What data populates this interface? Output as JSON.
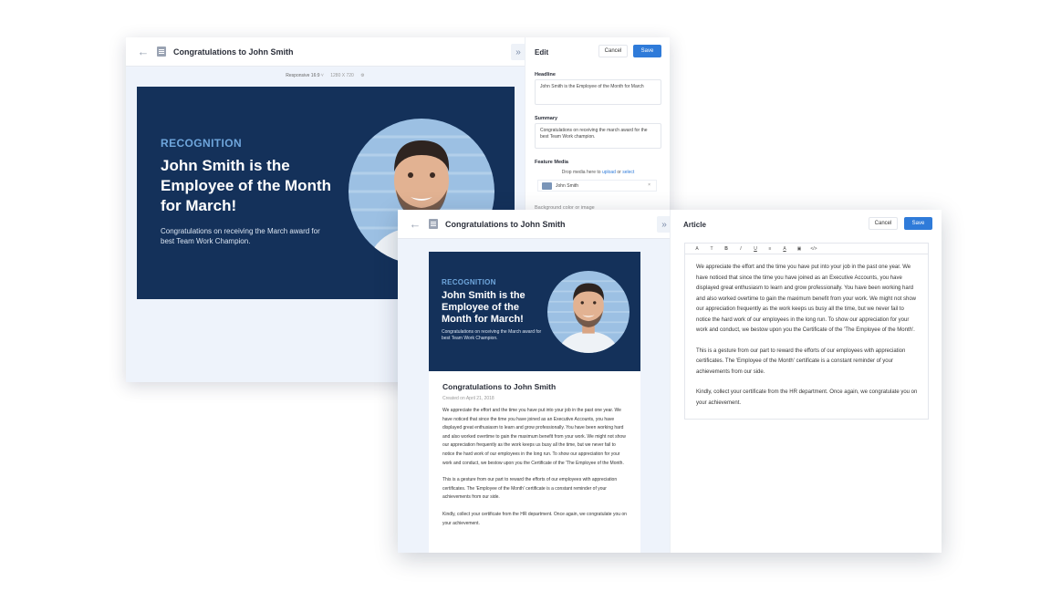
{
  "back_window": {
    "title": "Congratulations to John Smith",
    "responsive_label": "Responsive 16:9",
    "resolution": "1280 X 720",
    "panel_title": "Edit",
    "cancel_label": "Cancel",
    "save_label": "Save",
    "banner": {
      "kicker": "RECOGNITION",
      "headline": "John Smith is the Employee of the Month for March!",
      "subline": "Congratulations on receiving the March award for best Team Work Champion."
    },
    "form": {
      "headline_label": "Headline",
      "headline_value": "John Smith is the Employee of the Month for March",
      "summary_label": "Summary",
      "summary_value": "Congratulations on receiving the march award for the best Team Work champion.",
      "feature_media_label": "Feature Media",
      "drop_text": "Drop media here to",
      "upload_link": "upload",
      "or_text": "or",
      "select_link": "select",
      "media_item": "John Smith",
      "background_label": "Background color or image"
    }
  },
  "front_window": {
    "title": "Congratulations to John Smith",
    "panel_title": "Article",
    "cancel_label": "Cancel",
    "save_label": "Save",
    "banner": {
      "kicker": "RECOGNITION",
      "headline": "John Smith is the Employee of the Month for March!",
      "subline": "Congratulations on receiving the March award for best Team Work Champion."
    },
    "article": {
      "title": "Congratulations to John Smith",
      "date": "Created on April 21, 2018",
      "paragraphs": [
        "We appreciate the effort and the time you have put into your job in the past one year. We have noticed that since the time you have joined as an Executive Accounts, you have displayed great enthusiasm to learn and grow professionally. You have been working hard and also worked overtime to gain the maximum benefit from your work. We might not show our appreciation frequently as the work keeps us busy all the time, but we never fail to notice the hard work of our employees in the long run. To show our appreciation for your work and conduct, we bestow upon you the Certificate of the 'The Employee of the Month.",
        "This is a gesture from our part to reward the efforts of our employees with appreciation certificates. The 'Employee of the Month' certificate is a constant reminder of your achievements from our side.",
        "Kindly, collect your certificate from the HR department. Once again, we congratulate you on your achievement."
      ]
    },
    "editor": {
      "toolbar": [
        "A",
        "T",
        "B",
        "I",
        "U",
        "≡",
        "A",
        "▣",
        "</>"
      ],
      "paragraphs": [
        "We appreciate the effort and the time you have put into your job in the past one year. We have noticed that since the time you have joined as an Executive Accounts, you have displayed great enthusiasm to learn and grow professionally. You have been working hard and also worked overtime to gain the maximum benefit from your work. We might not show our appreciation frequently as the work keeps us busy all the time, but we never fail to notice the hard work of our employees in the long run. To show our appreciation for your work and conduct, we bestow upon you the Certificate of the 'The Employee of the Month'.",
        "This is a gesture from our part to reward the efforts of our employees with appreciation certificates. The 'Employee of the Month' certificate is a constant reminder of your achievements from our side.",
        "Kindly, collect your certificate from the HR department. Once again, we congratulate you on your achievement."
      ]
    }
  },
  "icons": {
    "back": "arrow-left-icon",
    "document": "document-icon",
    "collapse": "double-chevron-right-icon",
    "settings": "gear-icon"
  },
  "colors": {
    "banner_bg": "#14315a",
    "kicker": "#6fa6dc",
    "primary_button": "#2f7bd9",
    "canvas_bg": "#eef3fb"
  }
}
